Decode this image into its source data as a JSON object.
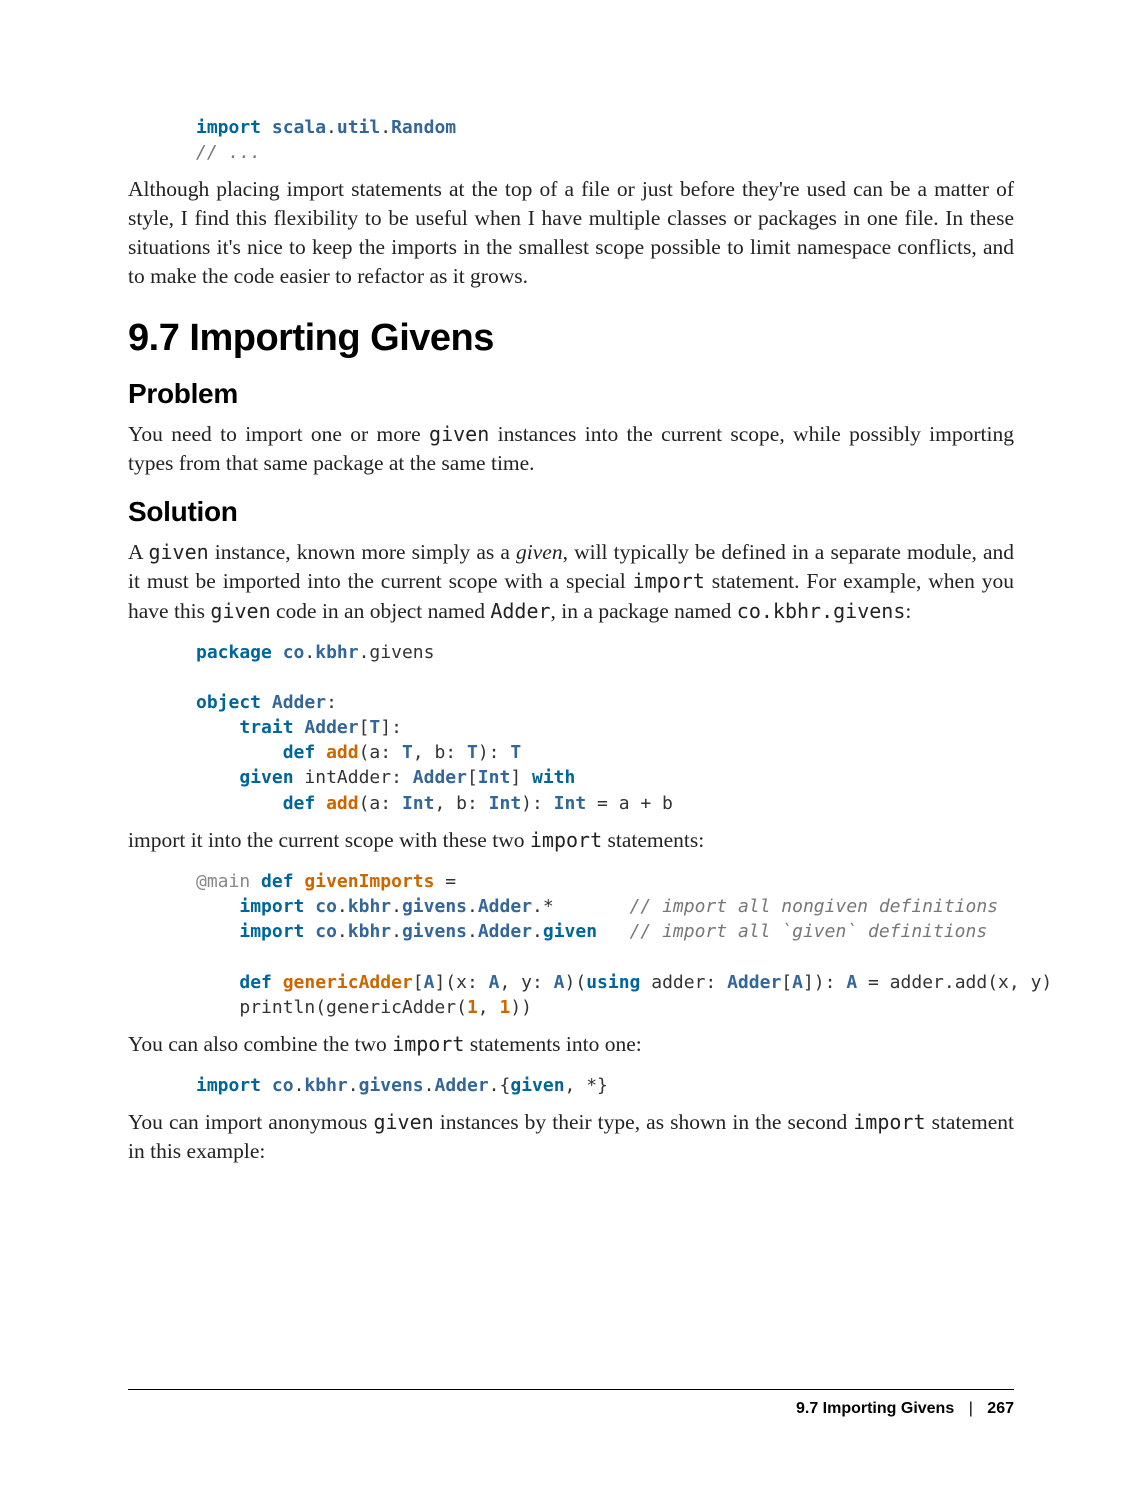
{
  "code1": {
    "line1_pre": "import ",
    "line1_pkg": "scala",
    "line1_dot1": ".",
    "line1_sub": "util",
    "line1_dot2": ".",
    "line1_cls": "Random",
    "line2": "// ..."
  },
  "para1": "Although placing import statements at the top of a file or just before they're used can be a matter of style, I find this flexibility to be useful when I have multiple classes or packages in one file. In these situations it's nice to keep the imports in the smallest scope possible to limit namespace conflicts, and to make the code easier to refactor as it grows.",
  "h1": "9.7 Importing Givens",
  "h2_problem": "Problem",
  "para2_a": "You need to import one or more ",
  "para2_code": "given",
  "para2_b": " instances into the current scope, while possibly importing types from that same package at the same time.",
  "h2_solution": "Solution",
  "para3_a": "A ",
  "para3_code1": "given",
  "para3_b": " instance, known more simply as a ",
  "para3_em": "given",
  "para3_c": ", will typically be defined in a separate module, and it must be imported into the current scope with a special ",
  "para3_code2": "import",
  "para3_d": " statement. For example, when you have this ",
  "para3_code3": "given",
  "para3_e": " code in an object named ",
  "para3_code4": "Adder",
  "para3_f": ", in a package named ",
  "para3_code5": "co.kbhr.givens",
  "para3_g": ":",
  "code2": {
    "l1": "package co.kbhr.givens",
    "l2": "",
    "l3": "object Adder:",
    "l4": "    trait Adder[T]:",
    "l5": "        def add(a: T, b: T): T",
    "l6": "    given intAdder: Adder[Int] with",
    "l7": "        def add(a: Int, b: Int): Int = a + b"
  },
  "para4_a": "import it into the current scope with these two ",
  "para4_code": "import",
  "para4_b": " statements:",
  "code3": {
    "l1": "@main def givenImports =",
    "l2": "    import co.kbhr.givens.Adder.*       // import all nongiven definitions",
    "l3": "    import co.kbhr.givens.Adder.given   // import all `given` definitions",
    "l4": "",
    "l5": "    def genericAdder[A](x: A, y: A)(using adder: Adder[A]): A = adder.add(x, y)",
    "l6": "    println(genericAdder(1, 1))"
  },
  "para5_a": "You can also combine the two ",
  "para5_code": "import",
  "para5_b": " statements into one:",
  "code4": {
    "l1": "import co.kbhr.givens.Adder.{given, *}"
  },
  "para6_a": "You can import anonymous ",
  "para6_code1": "given",
  "para6_b": " instances by their type, as shown in the second ",
  "para6_code2": "import",
  "para6_c": " statement in this example:",
  "footer": {
    "title": "9.7 Importing Givens",
    "sep": "|",
    "page": "267"
  }
}
